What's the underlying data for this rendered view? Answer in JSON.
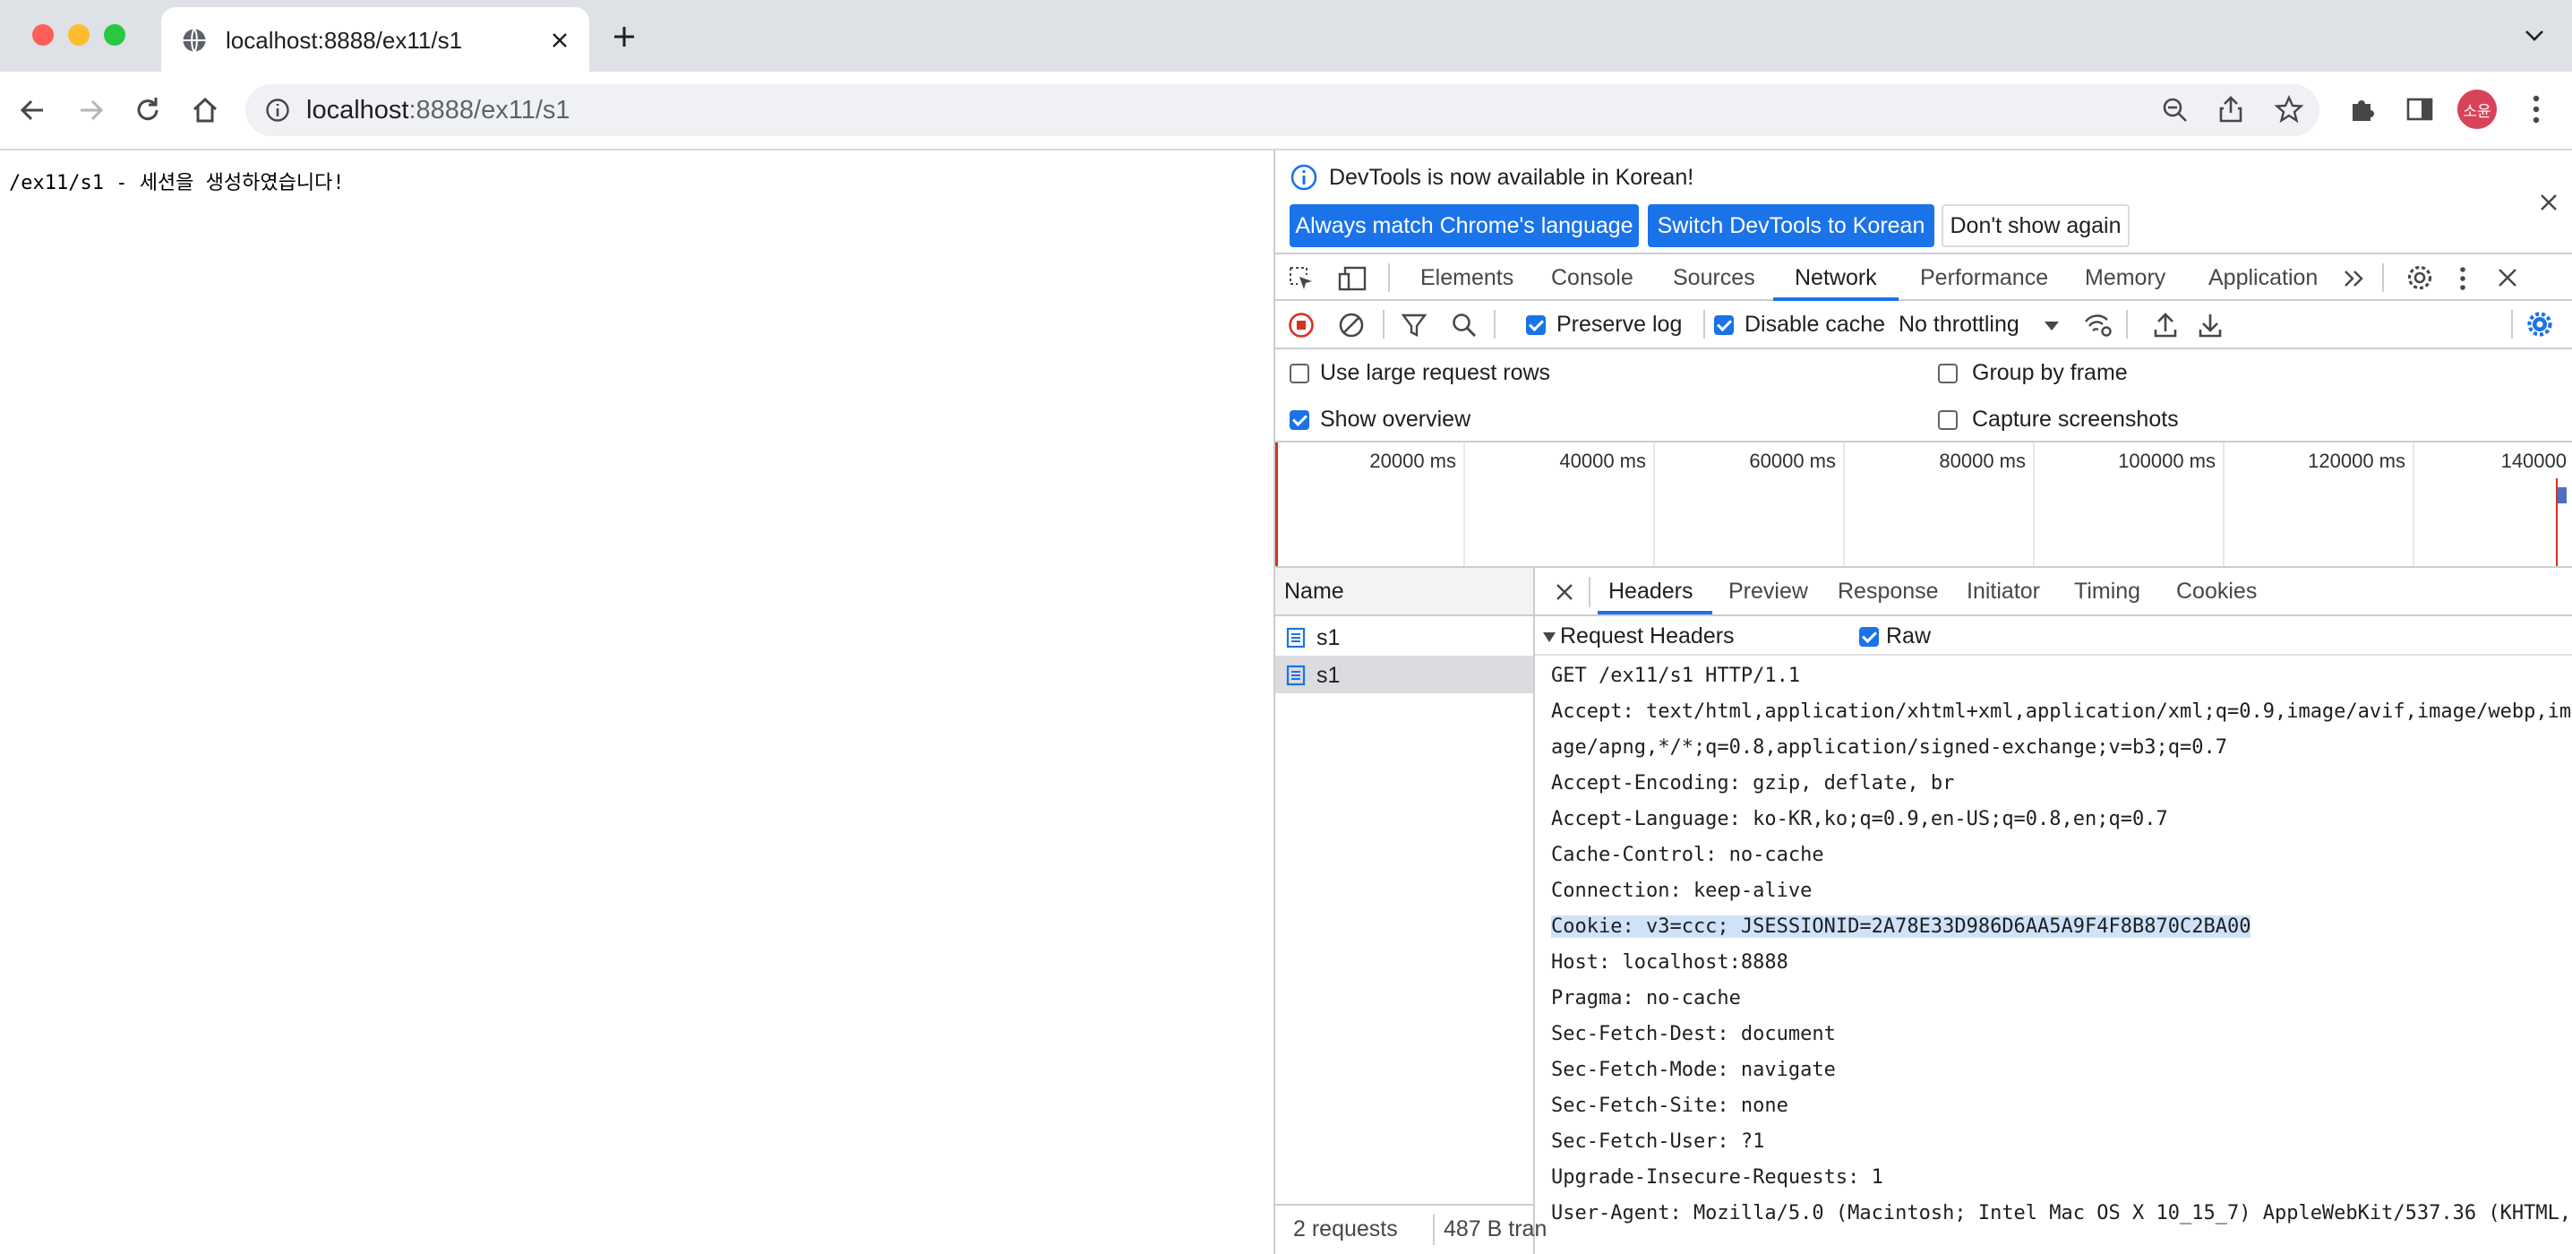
{
  "browser": {
    "tab_title": "localhost:8888/ex11/s1",
    "url_host": "localhost",
    "url_rest": ":8888/ex11/s1",
    "profile_label": "소윤"
  },
  "page": {
    "content": "/ex11/s1 - 세션을 생성하였습니다!"
  },
  "devtools": {
    "infobar": {
      "message": "DevTools is now available in Korean!",
      "match_button": "Always match Chrome's language",
      "switch_button": "Switch DevTools to Korean",
      "dismiss_button": "Don't show again"
    },
    "tabs": [
      "Elements",
      "Console",
      "Sources",
      "Network",
      "Performance",
      "Memory",
      "Application"
    ],
    "active_tab": "Network",
    "network_toolbar": {
      "preserve_log": "Preserve log",
      "disable_cache": "Disable cache",
      "throttling": "No throttling"
    },
    "settings": {
      "large_rows": "Use large request rows",
      "show_overview": "Show overview",
      "group_by_frame": "Group by frame",
      "capture_screenshots": "Capture screenshots"
    },
    "overview_ticks": [
      "20000 ms",
      "40000 ms",
      "60000 ms",
      "80000 ms",
      "100000 ms",
      "120000 ms",
      "140000"
    ],
    "name_header": "Name",
    "requests": [
      "s1",
      "s1"
    ],
    "status": {
      "requests": "2 requests",
      "transferred": "487 B tran"
    },
    "detail_tabs": [
      "Headers",
      "Preview",
      "Response",
      "Initiator",
      "Timing",
      "Cookies"
    ],
    "section_title": "Request Headers",
    "raw_label": "Raw",
    "raw_headers": [
      "GET /ex11/s1 HTTP/1.1",
      "Accept: text/html,application/xhtml+xml,application/xml;q=0.9,image/avif,image/webp,im",
      "age/apng,*/*;q=0.8,application/signed-exchange;v=b3;q=0.7",
      "Accept-Encoding: gzip, deflate, br",
      "Accept-Language: ko-KR,ko;q=0.9,en-US;q=0.8,en;q=0.7",
      "Cache-Control: no-cache",
      "Connection: keep-alive",
      "Cookie: v3=ccc; JSESSIONID=2A78E33D986D6AA5A9F4F8B870C2BA00",
      "Host: localhost:8888",
      "Pragma: no-cache",
      "Sec-Fetch-Dest: document",
      "Sec-Fetch-Mode: navigate",
      "Sec-Fetch-Site: none",
      "Sec-Fetch-User: ?1",
      "Upgrade-Insecure-Requests: 1",
      "User-Agent: Mozilla/5.0 (Macintosh; Intel Mac OS X 10_15_7) AppleWebKit/537.36 (KHTML,"
    ]
  }
}
